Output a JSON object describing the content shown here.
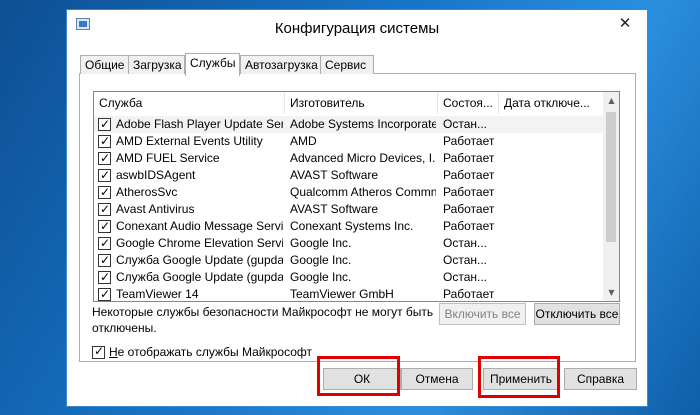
{
  "window": {
    "title": "Конфигурация системы",
    "close_glyph": "✕"
  },
  "tabs": [
    "Общие",
    "Загрузка",
    "Службы",
    "Автозагрузка",
    "Сервис"
  ],
  "columns": [
    "Служба",
    "Изготовитель",
    "Состоя...",
    "Дата отключе..."
  ],
  "services": [
    {
      "name": "Adobe Flash Player Update Service",
      "maker": "Adobe Systems Incorporated",
      "status": "Остан...",
      "date": ""
    },
    {
      "name": "AMD External Events Utility",
      "maker": "AMD",
      "status": "Работает",
      "date": ""
    },
    {
      "name": "AMD FUEL Service",
      "maker": "Advanced Micro Devices, I...",
      "status": "Работает",
      "date": ""
    },
    {
      "name": "aswbIDSAgent",
      "maker": "AVAST Software",
      "status": "Работает",
      "date": ""
    },
    {
      "name": "AtherosSvc",
      "maker": "Qualcomm Atheros Commn...",
      "status": "Работает",
      "date": ""
    },
    {
      "name": "Avast Antivirus",
      "maker": "AVAST Software",
      "status": "Работает",
      "date": ""
    },
    {
      "name": "Conexant Audio Message Service",
      "maker": "Conexant Systems Inc.",
      "status": "Работает",
      "date": ""
    },
    {
      "name": "Google Chrome Elevation Service",
      "maker": "Google Inc.",
      "status": "Остан...",
      "date": ""
    },
    {
      "name": "Служба Google Update (gupdate)",
      "maker": "Google Inc.",
      "status": "Остан...",
      "date": ""
    },
    {
      "name": "Служба Google Update (gupdate...",
      "maker": "Google Inc.",
      "status": "Остан...",
      "date": ""
    },
    {
      "name": "TeamViewer 14",
      "maker": "TeamViewer GmbH",
      "status": "Работает",
      "date": ""
    }
  ],
  "scroll": {
    "up_glyph": "▲",
    "down_glyph": "▼"
  },
  "note": {
    "line1": "Некоторые службы безопасности Майкрософт не могут быть",
    "line2": "отключены."
  },
  "buttons": {
    "enable_all": "Включить все",
    "disable_all": "Отключить все",
    "ok": "ОК",
    "cancel": "Отмена",
    "apply": "Применить",
    "help": "Справка"
  },
  "hide_ms": {
    "first_letter": "Н",
    "rest": "е отображать службы Майкрософт"
  }
}
